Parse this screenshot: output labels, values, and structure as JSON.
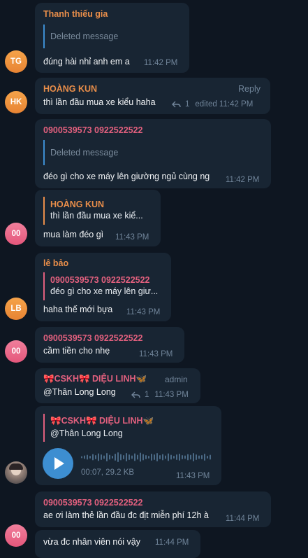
{
  "colors": {
    "background": "#0e1621",
    "bubble": "#182533",
    "orange_name": "#e98e4a",
    "pink_name": "#e2607e",
    "link_blue": "#3d8ed1",
    "time_gray": "#708499"
  },
  "messages": [
    {
      "sender": "Thanh thiếu gia",
      "quote_text": "Deleted message",
      "text": "đúng hài nhỉ anh em a",
      "time": "11:42 PM",
      "avatar": "TG"
    },
    {
      "sender": "HOÀNG KUN",
      "reply_label": "Reply",
      "text": "thì lần đầu mua xe kiểu haha",
      "reply_count": "1",
      "time": "edited 11:42 PM",
      "avatar": "HK"
    },
    {
      "sender": "0900539573 0922522522",
      "quote_text": "Deleted message",
      "text": "đéo gì cho xe máy lên giường ngủ cùng ng",
      "time": "11:42 PM"
    },
    {
      "quote_name": "HOÀNG KUN",
      "quote_text": "thì lần đầu mua xe kiể...",
      "text": "mua làm đéo gì",
      "time": "11:43 PM",
      "avatar": "00"
    },
    {
      "sender": "lê bảo",
      "quote_name": "0900539573 0922522522",
      "quote_text": "đéo gì cho xe máy lên giư...",
      "text": "haha thế mới bựa",
      "time": "11:43 PM",
      "avatar": "LB"
    },
    {
      "sender": "0900539573 0922522522",
      "text": "cầm tiền cho nhẹ",
      "time": "11:43 PM",
      "avatar": "00"
    },
    {
      "sender": "🎀CSKH🎀 DIỆU LINH🦋",
      "badge": "admin",
      "text": "@Thân Long Long",
      "reply_count": "1",
      "time": "11:43 PM"
    },
    {
      "quote_name": "🎀CSKH🎀 DIỆU LINH🦋",
      "quote_text": "@Thân Long Long",
      "voice_duration": "00:07, 29.2 KB",
      "time": "11:43 PM"
    },
    {
      "sender": "0900539573 0922522522",
      "text": "ae ơi làm thẻ lần đầu đc địt miễn phí 12h à",
      "time": "11:44 PM"
    },
    {
      "text": "vừa đc nhân viên nói vậy",
      "time": "11:44 PM",
      "avatar": "00"
    }
  ]
}
